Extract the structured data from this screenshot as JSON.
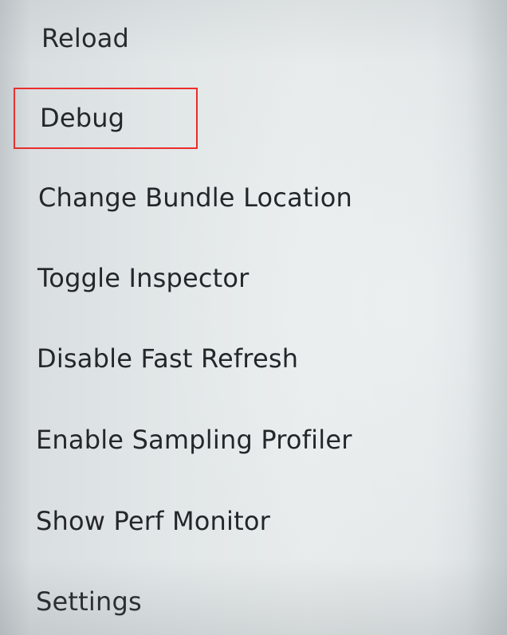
{
  "menu": {
    "items": [
      {
        "label": "Reload"
      },
      {
        "label": "Debug"
      },
      {
        "label": "Change Bundle Location"
      },
      {
        "label": "Toggle Inspector"
      },
      {
        "label": "Disable Fast Refresh"
      },
      {
        "label": "Enable Sampling Profiler"
      },
      {
        "label": "Show Perf Monitor"
      },
      {
        "label": "Settings"
      }
    ]
  },
  "colors": {
    "text": "#242729",
    "highlight_border": "#ee2c2c",
    "background": "#e4e8e9"
  }
}
